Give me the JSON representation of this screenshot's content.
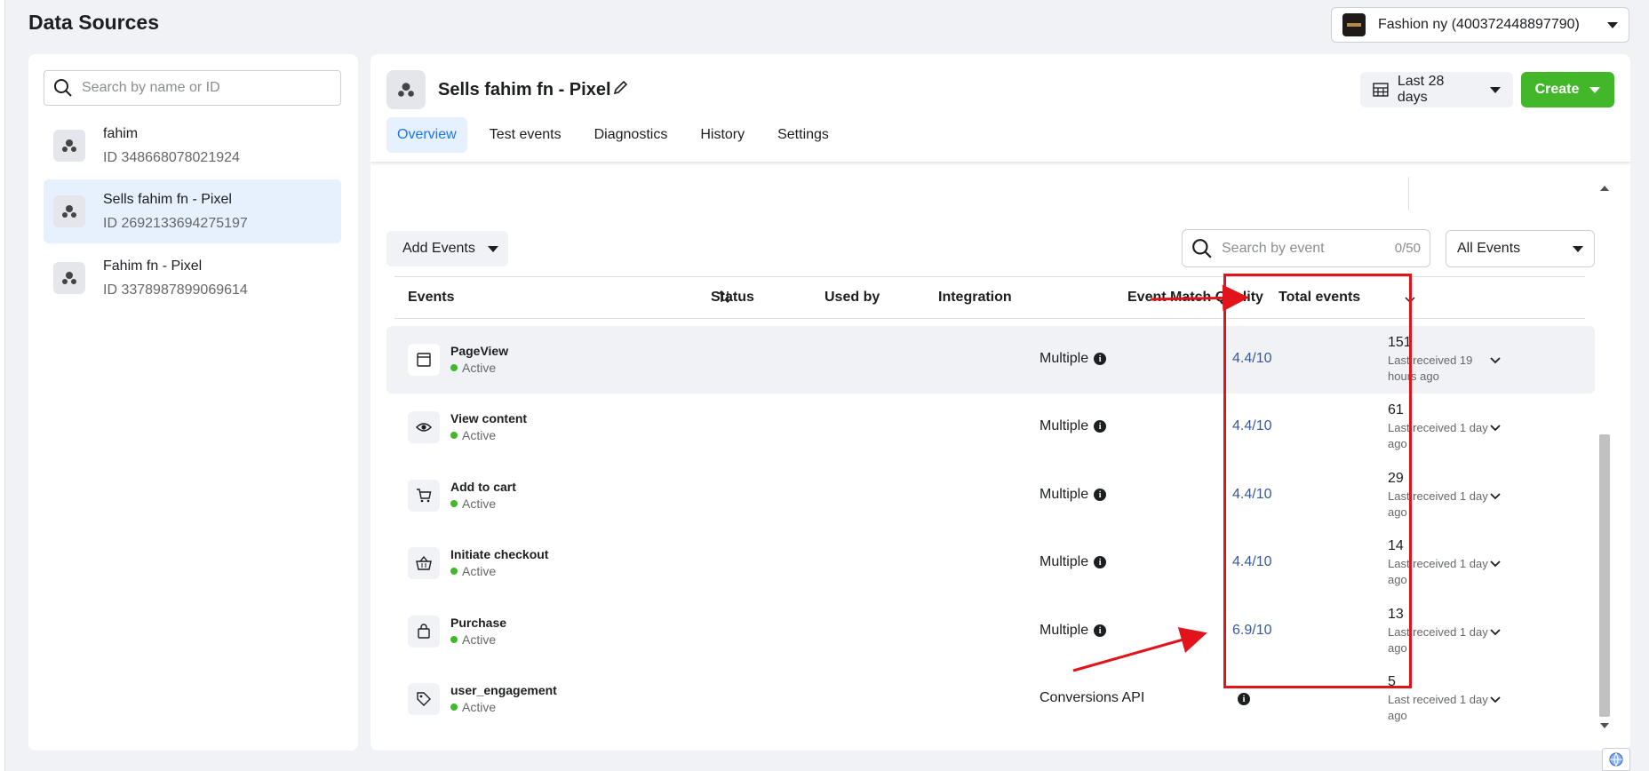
{
  "page": {
    "title": "Data Sources"
  },
  "account": {
    "name": "Fashion ny (400372448897790)"
  },
  "sidebar": {
    "search_placeholder": "Search by name or ID",
    "sources": [
      {
        "name": "fahim",
        "id": "ID 348668078021924"
      },
      {
        "name": "Sells fahim fn - Pixel",
        "id": "ID 2692133694275197"
      },
      {
        "name": "Fahim fn - Pixel",
        "id": "ID 3378987899069614"
      }
    ]
  },
  "header": {
    "pixel_name": "Sells fahim fn - Pixel",
    "date_range": "Last 28 days",
    "create_label": "Create",
    "tabs": [
      "Overview",
      "Test events",
      "Diagnostics",
      "History",
      "Settings"
    ]
  },
  "toolbar": {
    "add_events_label": "Add Events",
    "search_placeholder": "Search by event",
    "search_count": "0/50",
    "filter_label": "All Events"
  },
  "table": {
    "columns": [
      "Events",
      "Status",
      "Used by",
      "Integration",
      "Event Match Quality",
      "Total events"
    ],
    "rows": [
      {
        "name": "PageView",
        "status": "Active",
        "integration": "Multiple",
        "emq": "4.4/10",
        "total": "151",
        "last": "Last received 19 hours ago",
        "icon": "browser-window-icon"
      },
      {
        "name": "View content",
        "status": "Active",
        "integration": "Multiple",
        "emq": "4.4/10",
        "total": "61",
        "last": "Last received 1 day ago",
        "icon": "eye-icon"
      },
      {
        "name": "Add to cart",
        "status": "Active",
        "integration": "Multiple",
        "emq": "4.4/10",
        "total": "29",
        "last": "Last received 1 day ago",
        "icon": "cart-icon"
      },
      {
        "name": "Initiate checkout",
        "status": "Active",
        "integration": "Multiple",
        "emq": "4.4/10",
        "total": "14",
        "last": "Last received 1 day ago",
        "icon": "basket-icon"
      },
      {
        "name": "Purchase",
        "status": "Active",
        "integration": "Multiple",
        "emq": "6.9/10",
        "total": "13",
        "last": "Last received 1 day ago",
        "icon": "shopping-bag-icon"
      },
      {
        "name": "user_engagement",
        "status": "Active",
        "integration": "Conversions API",
        "emq": "",
        "total": "5",
        "last": "Last received 1 day ago",
        "icon": "tag-icon"
      }
    ]
  },
  "colors": {
    "accent": "#1877f2",
    "create": "#42b72a",
    "annotation": "#e0141a",
    "emq_link": "#385898"
  }
}
